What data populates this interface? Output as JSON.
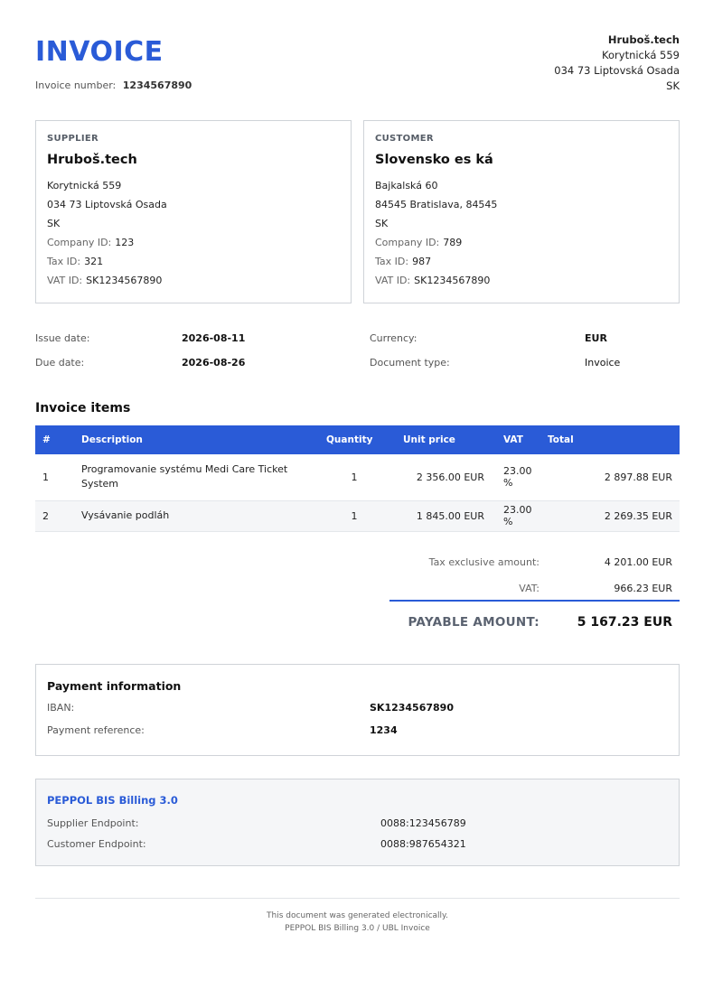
{
  "header": {
    "title": "INVOICE",
    "invoice_number_label": "Invoice number:",
    "invoice_number": "1234567890"
  },
  "issuer": {
    "name": "Hruboš.tech",
    "street": "Korytnická 559",
    "city": "034 73 Liptovská Osada",
    "country": "SK"
  },
  "supplier": {
    "label": "SUPPLIER",
    "name": "Hruboš.tech",
    "street": "Korytnická 559",
    "city": "034 73 Liptovská Osada",
    "country": "SK",
    "company_id_label": "Company ID:",
    "company_id": "123",
    "tax_id_label": "Tax ID:",
    "tax_id": "321",
    "vat_id_label": "VAT ID:",
    "vat_id": "SK1234567890"
  },
  "customer": {
    "label": "CUSTOMER",
    "name": "Slovensko es ká",
    "street": "Bajkalská 60",
    "city": "84545 Bratislava, 84545",
    "country": "SK",
    "company_id_label": "Company ID:",
    "company_id": "789",
    "tax_id_label": "Tax ID:",
    "tax_id": "987",
    "vat_id_label": "VAT ID:",
    "vat_id": "SK1234567890"
  },
  "meta": {
    "issue_date_label": "Issue date:",
    "issue_date": "2026-08-11",
    "due_date_label": "Due date:",
    "due_date": "2026-08-26",
    "currency_label": "Currency:",
    "currency": "EUR",
    "doc_type_label": "Document type:",
    "doc_type": "Invoice"
  },
  "items": {
    "title": "Invoice items",
    "columns": [
      "#",
      "Description",
      "Quantity",
      "Unit price",
      "VAT",
      "Total"
    ],
    "rows": [
      {
        "num": "1",
        "description": "Programovanie systému Medi Care Ticket System",
        "quantity": "1",
        "unit_price": "2 356.00 EUR",
        "vat": "23.00 %",
        "total": "2 897.88 EUR"
      },
      {
        "num": "2",
        "description": "Vysávanie podláh",
        "quantity": "1",
        "unit_price": "1 845.00 EUR",
        "vat": "23.00 %",
        "total": "2 269.35 EUR"
      }
    ]
  },
  "totals": {
    "tax_exclusive_label": "Tax exclusive amount:",
    "tax_exclusive": "4 201.00 EUR",
    "vat_label": "VAT:",
    "vat": "966.23 EUR",
    "payable_label": "PAYABLE AMOUNT:",
    "payable": "5 167.23 EUR"
  },
  "payment": {
    "title": "Payment information",
    "iban_label": "IBAN:",
    "iban": "SK1234567890",
    "reference_label": "Payment reference:",
    "reference": "1234"
  },
  "peppol": {
    "title": "PEPPOL BIS Billing 3.0",
    "supplier_endpoint_label": "Supplier Endpoint:",
    "supplier_endpoint": "0088:123456789",
    "customer_endpoint_label": "Customer Endpoint:",
    "customer_endpoint": "0088:987654321"
  },
  "footer": {
    "line1": "This document was generated electronically.",
    "line2": "PEPPOL BIS Billing 3.0 / UBL Invoice"
  },
  "colors": {
    "accent": "#2a5bd7",
    "border": "#cfd3d8",
    "muted_bg": "#f5f6f8"
  }
}
